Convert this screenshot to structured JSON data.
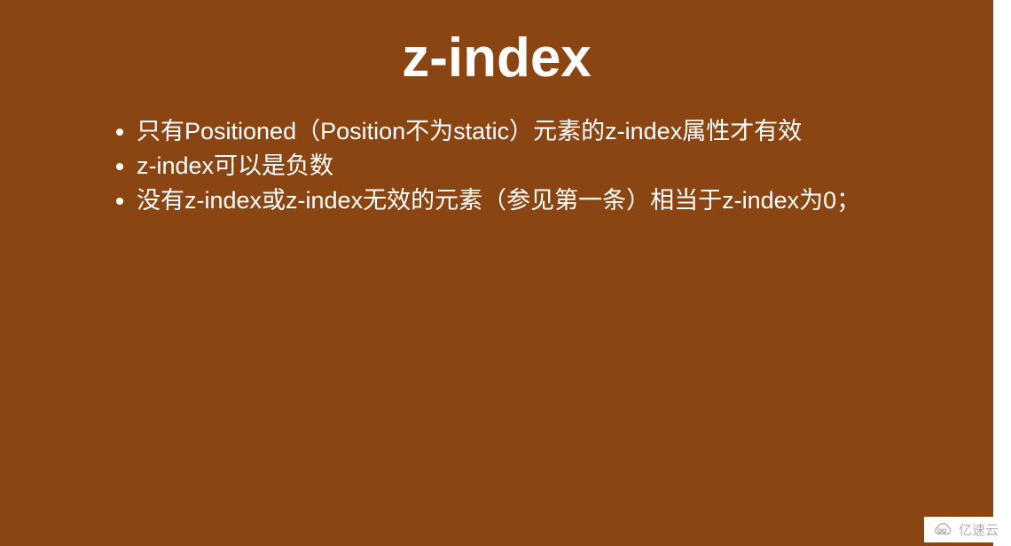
{
  "slide": {
    "title": "z-index",
    "bullets": [
      "只有Positioned（Position不为static）元素的z-index属性才有效",
      "z-index可以是负数",
      "没有z-index或z-index无效的元素（参见第一条）相当于z-index为0；"
    ]
  },
  "watermark": {
    "text": "亿速云"
  },
  "colors": {
    "background": "#8b4513",
    "text": "#ffffff",
    "watermark": "#b0b0b0"
  }
}
